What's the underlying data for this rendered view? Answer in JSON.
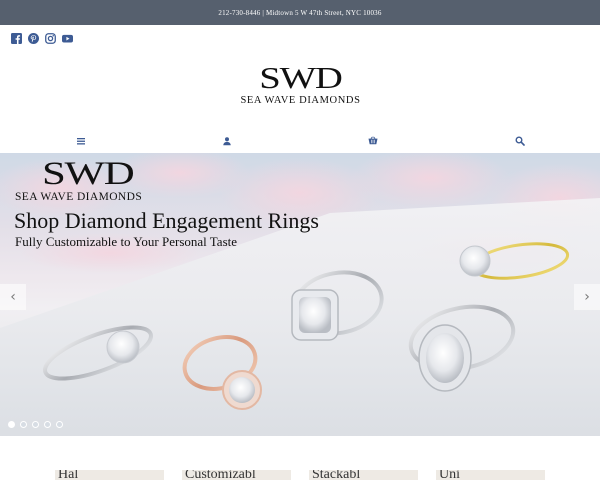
{
  "topbar": {
    "text": "212-730-8446 | Midtown 5 W 47th Street, NYC 10036"
  },
  "social": {
    "icons": [
      "facebook-icon",
      "pinterest-icon",
      "instagram-icon",
      "youtube-icon"
    ]
  },
  "logo": {
    "monogram": "SWD",
    "name": "SEA WAVE DIAMONDS"
  },
  "nav": {
    "icons": [
      "menu-icon",
      "account-icon",
      "cart-icon",
      "search-icon"
    ],
    "color": "#3d5b94"
  },
  "hero": {
    "monogram": "SWD",
    "brand": "SEA WAVE DIAMONDS",
    "title": "Shop Diamond Engagement Rings",
    "subtitle": "Fully Customizable to Your Personal Taste",
    "prev_label": "‹",
    "next_label": "›",
    "slide_count": 5,
    "active_slide": 1
  },
  "cards": [
    {
      "label": "Hal"
    },
    {
      "label": "Customizabl"
    },
    {
      "label": "Stackabl"
    },
    {
      "label": "Uni"
    }
  ],
  "colors": {
    "topbar": "#56606e",
    "nav_icon": "#3d5b94",
    "card_bg": "#eeeae4"
  }
}
